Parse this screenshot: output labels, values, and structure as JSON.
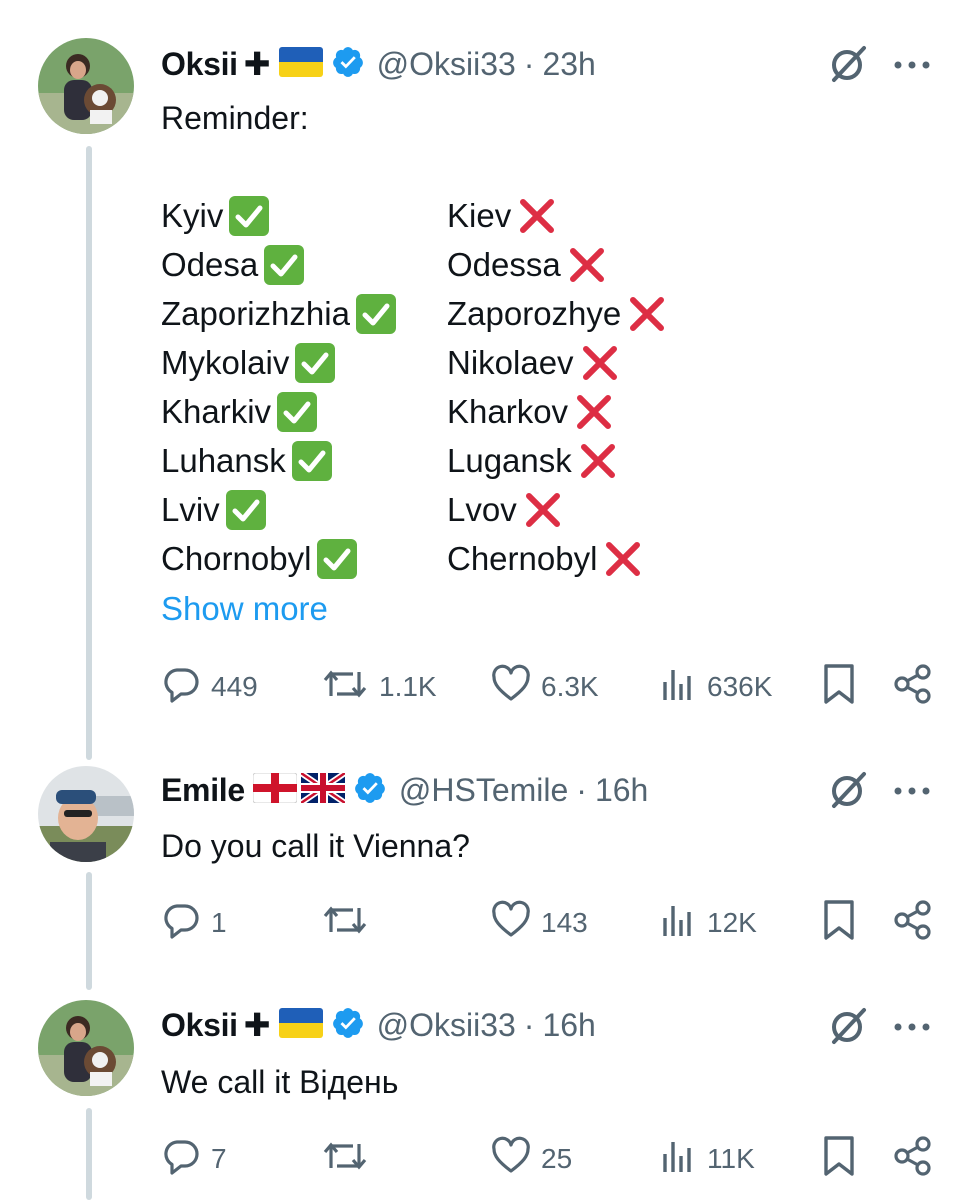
{
  "tweets": [
    {
      "name": "Oksii",
      "name_suffix": "✚",
      "handle": "@Oksii33",
      "separator": "·",
      "time": "23h",
      "text": "Reminder:",
      "cities_correct": [
        "Kyiv",
        "Odesa",
        "Zaporizhzhia",
        "Mykolaiv",
        "Kharkiv",
        "Luhansk",
        "Lviv",
        "Chornobyl"
      ],
      "cities_wrong": [
        "Kiev",
        "Odessa",
        "Zaporozhye",
        "Nikolaev",
        "Kharkov",
        "Lugansk",
        "Lvov",
        "Chernobyl"
      ],
      "show_more": "Show more",
      "stats": {
        "replies": "449",
        "reposts": "1.1K",
        "likes": "6.3K",
        "views": "636K"
      }
    },
    {
      "name": "Emile",
      "handle": "@HSTemile",
      "separator": "·",
      "time": "16h",
      "text": "Do you call it Vienna?",
      "stats": {
        "replies": "1",
        "reposts": "",
        "likes": "143",
        "views": "12K"
      }
    },
    {
      "name": "Oksii",
      "name_suffix": "✚",
      "handle": "@Oksii33",
      "separator": "·",
      "time": "16h",
      "text": "We call it Відень",
      "stats": {
        "replies": "7",
        "reposts": "",
        "likes": "25",
        "views": "11K"
      }
    }
  ],
  "icons": {
    "verified": "verified-badge-icon",
    "flag_ukraine": "ukraine-flag-icon",
    "flag_england": "england-flag-icon",
    "flag_uk": "uk-flag-icon",
    "check": "green-check-icon",
    "cross": "red-cross-icon",
    "grok": "grok-icon",
    "more": "more-options-icon",
    "reply": "reply-icon",
    "repost": "repost-icon",
    "like": "like-icon",
    "views": "views-icon",
    "bookmark": "bookmark-icon",
    "share": "share-icon"
  },
  "colors": {
    "verified": "#1d9bf0",
    "link": "#1d9bf0",
    "check_bg": "#5fb13f",
    "cross": "#dd2e44",
    "muted": "#536471",
    "thread_line": "#cfd9de",
    "ukraine_blue": "#1f5fb8",
    "ukraine_yellow": "#f7d117"
  }
}
